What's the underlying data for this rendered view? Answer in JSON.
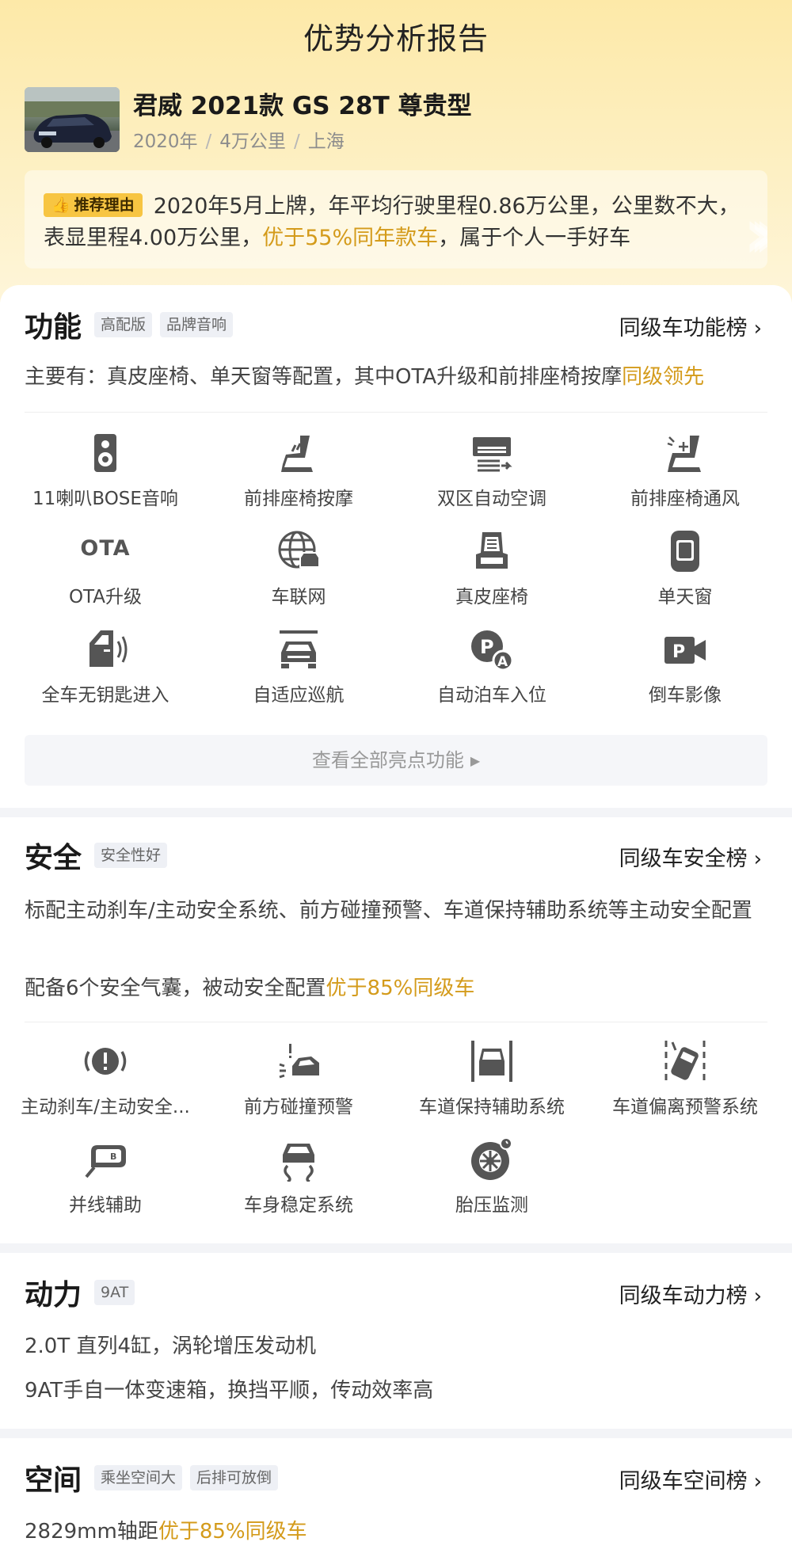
{
  "page_title": "优势分析报告",
  "car": {
    "name": "君威 2021款 GS 28T 尊贵型",
    "year": "2020年",
    "mileage": "4万公里",
    "city": "上海",
    "meta_separator": "/"
  },
  "reason": {
    "tag": "推荐理由",
    "text_1": "2020年5月上牌，年平均行驶里程0.86万公里，公里数不大，表显里程4.00万公里，",
    "highlight": "优于55%同年款车",
    "text_2": "，属于个人一手好车"
  },
  "function": {
    "title": "功能",
    "chips": [
      "高配版",
      "品牌音响"
    ],
    "rank_link": "同级车功能榜",
    "summary": "主要有：真皮座椅、单天窗等配置，其中OTA升级和前排座椅按摩",
    "summary_highlight": "同级领先",
    "features": [
      {
        "label": "11喇叭BOSE音响",
        "icon": "speaker-icon"
      },
      {
        "label": "前排座椅按摩",
        "icon": "seat-massage-icon"
      },
      {
        "label": "双区自动空调",
        "icon": "air-conditioner-icon"
      },
      {
        "label": "前排座椅通风",
        "icon": "seat-ventilation-icon"
      },
      {
        "label": "OTA升级",
        "icon": "ota-icon",
        "icon_text": "OTA"
      },
      {
        "label": "车联网",
        "icon": "connected-car-icon"
      },
      {
        "label": "真皮座椅",
        "icon": "leather-seat-icon"
      },
      {
        "label": "单天窗",
        "icon": "sunroof-icon"
      },
      {
        "label": "全车无钥匙进入",
        "icon": "keyless-entry-icon"
      },
      {
        "label": "自适应巡航",
        "icon": "adaptive-cruise-icon"
      },
      {
        "label": "自动泊车入位",
        "icon": "auto-parking-icon"
      },
      {
        "label": "倒车影像",
        "icon": "reverse-camera-icon"
      }
    ],
    "view_all": "查看全部亮点功能"
  },
  "safety": {
    "title": "安全",
    "chips": [
      "安全性好"
    ],
    "rank_link": "同级车安全榜",
    "line1": "标配主动刹车/主动安全系统、前方碰撞预警、车道保持辅助系统等主动安全配置",
    "line2": "配备6个安全气囊，被动安全配置",
    "line2_highlight": "优于85%同级车",
    "features": [
      {
        "label": "主动刹车/主动安全...",
        "icon": "active-brake-icon"
      },
      {
        "label": "前方碰撞预警",
        "icon": "collision-warning-icon"
      },
      {
        "label": "车道保持辅助系统",
        "icon": "lane-keeping-icon"
      },
      {
        "label": "车道偏离预警系统",
        "icon": "lane-departure-icon"
      },
      {
        "label": "并线辅助",
        "icon": "blind-spot-icon"
      },
      {
        "label": "车身稳定系统",
        "icon": "stability-control-icon"
      },
      {
        "label": "胎压监测",
        "icon": "tire-pressure-icon"
      }
    ]
  },
  "power": {
    "title": "动力",
    "chips": [
      "9AT"
    ],
    "rank_link": "同级车动力榜",
    "line1": "2.0T 直列4缸，涡轮增压发动机",
    "line2": "9AT手自一体变速箱，换挡平顺，传动效率高"
  },
  "space": {
    "title": "空间",
    "chips": [
      "乘坐空间大",
      "后排可放倒"
    ],
    "rank_link": "同级车空间榜",
    "line1": "2829mm轴距",
    "line1_highlight": "优于85%同级车"
  },
  "colors": {
    "highlight": "#d49b1b",
    "tag_bg": "#f7c542",
    "icon": "#555555"
  }
}
